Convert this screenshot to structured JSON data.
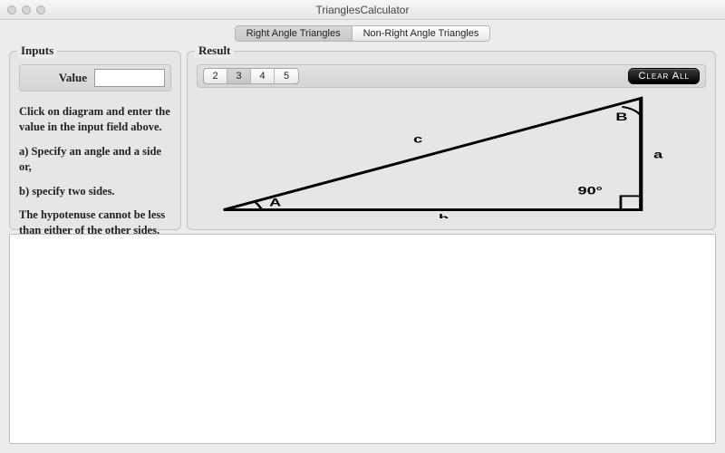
{
  "window": {
    "title": "TrianglesCalculator"
  },
  "tabs": {
    "items": [
      {
        "label": "Right Angle Triangles",
        "active": true
      },
      {
        "label": "Non-Right Angle Triangles",
        "active": false
      }
    ]
  },
  "inputs": {
    "title": "Inputs",
    "value_label": "Value",
    "value": "",
    "placeholder": ""
  },
  "instructions": {
    "line1": "Click on diagram and enter the value in the input field above.",
    "line2": "a) Specify an angle and a side or,",
    "line3": "b) specify two sides.",
    "line4": "The hypotenuse cannot be less than either of the other sides."
  },
  "result": {
    "title": "Result",
    "precision_options": [
      "2",
      "3",
      "4",
      "5"
    ],
    "precision_selected": "3",
    "clear_all": "Clear All"
  },
  "diagram": {
    "angle_A": "A",
    "angle_B": "B",
    "right_angle": "90°",
    "side_a": "a",
    "side_b": "b",
    "side_c": "c"
  }
}
